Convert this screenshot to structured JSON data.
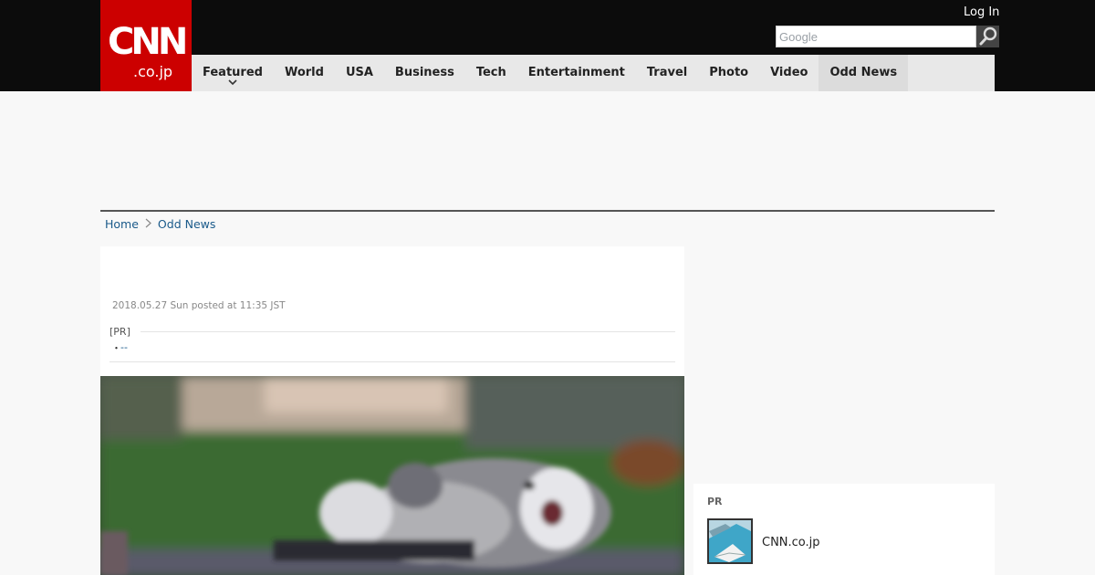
{
  "header": {
    "logo_text": "CNN",
    "logo_sub": ".co.jp",
    "login_label": "Log In",
    "search_placeholder": "Google",
    "brand_color": "#cc0000"
  },
  "nav": {
    "items": [
      {
        "label": "Featured",
        "has_dropdown": true
      },
      {
        "label": "World"
      },
      {
        "label": "USA"
      },
      {
        "label": "Business"
      },
      {
        "label": "Tech"
      },
      {
        "label": "Entertainment"
      },
      {
        "label": "Travel"
      },
      {
        "label": "Photo"
      },
      {
        "label": "Video"
      },
      {
        "label": "Odd News",
        "active": true
      }
    ]
  },
  "breadcrumb": {
    "home": "Home",
    "current": "Odd News"
  },
  "article": {
    "posted": "2018.05.27 Sun posted at 11:35 JST",
    "pr_label": "[PR]",
    "pr_bullet": "・",
    "pr_link": "--"
  },
  "sidebar": {
    "pr_label": "PR",
    "site_name": "CNN.co.jp"
  },
  "icons": {
    "search": "magnifier-icon",
    "caret": "chevron-down-icon",
    "breadcrumb_sep": "chevron-right-icon"
  }
}
